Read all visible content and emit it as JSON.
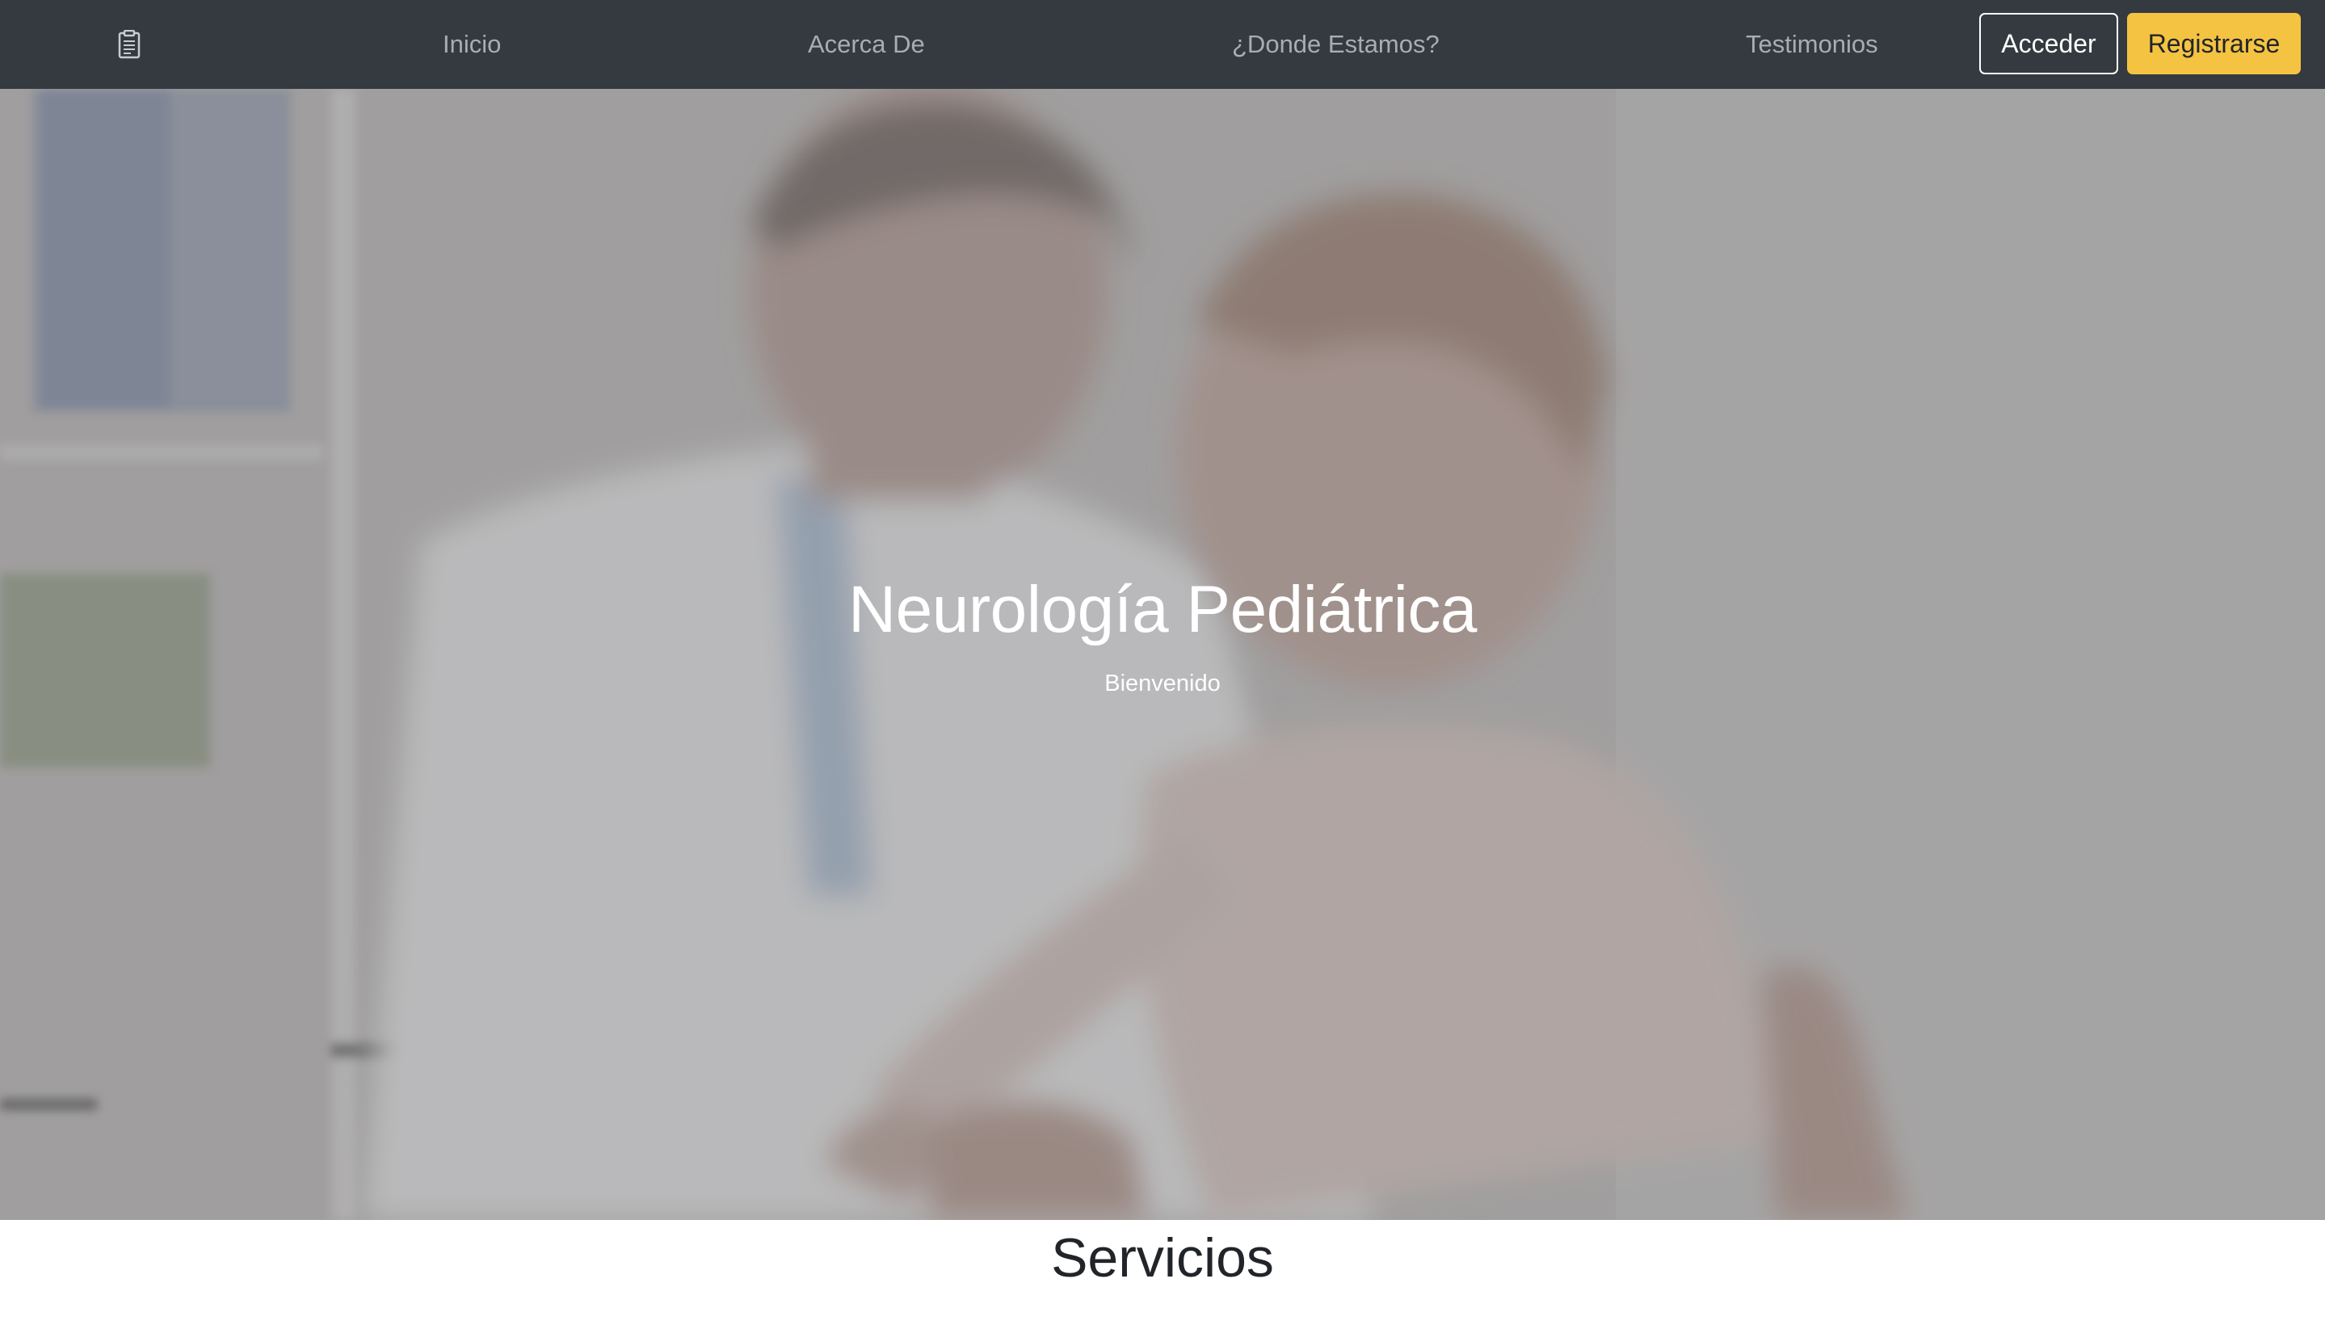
{
  "navbar": {
    "brand_icon": "clipboard-icon",
    "links": [
      {
        "label": "Inicio"
      },
      {
        "label": "Acerca De"
      },
      {
        "label": "¿Donde Estamos?"
      },
      {
        "label": "Testimonios"
      }
    ],
    "login_label": "Acceder",
    "register_label": "Registrarse"
  },
  "hero": {
    "title": "Neurología Pediátrica",
    "subtitle": "Bienvenido"
  },
  "services": {
    "title": "Servicios"
  },
  "colors": {
    "navbar_bg": "#343a40",
    "nav_link": "#a9adb2",
    "register_button": "#f5c342"
  }
}
